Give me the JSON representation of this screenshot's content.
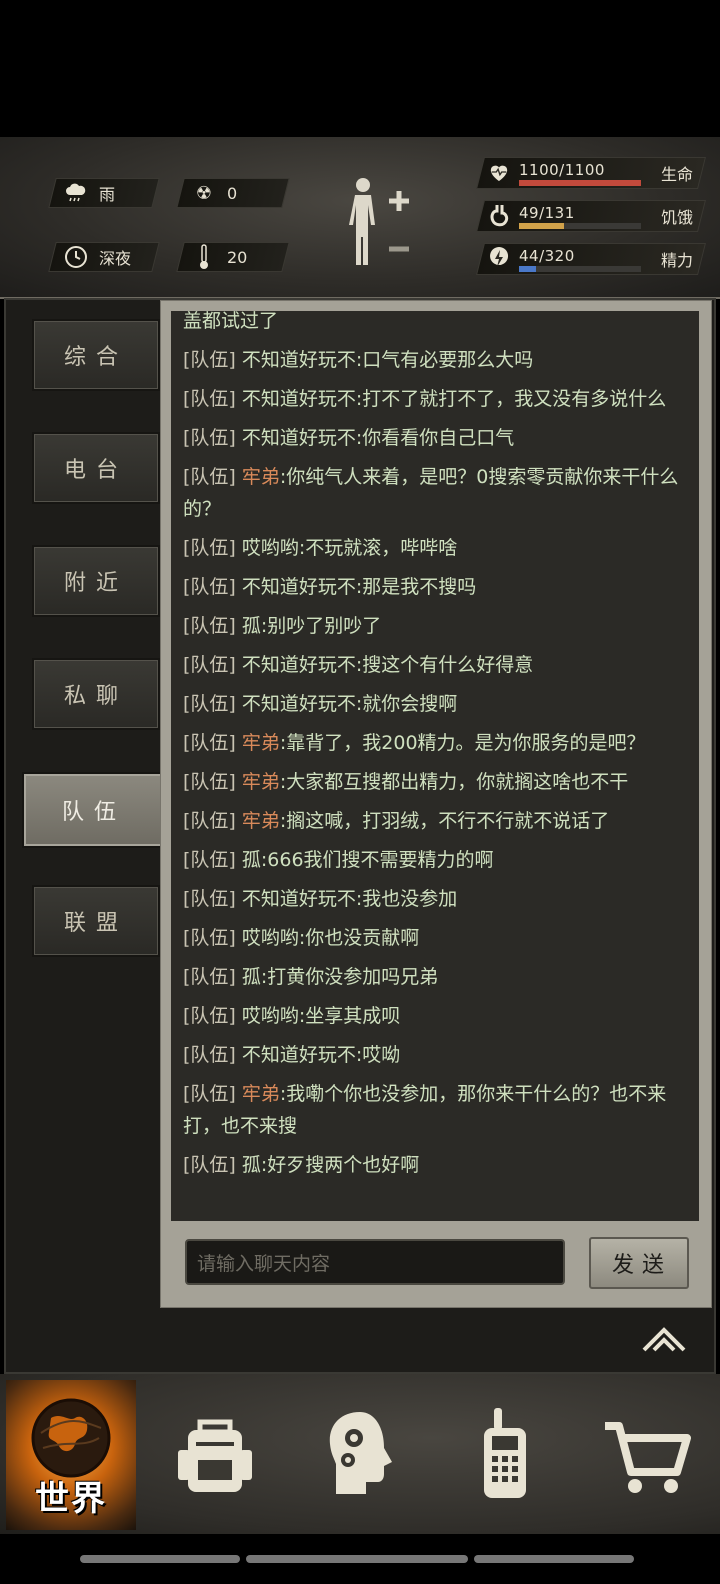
{
  "hud": {
    "weather": "雨",
    "radiation": "0",
    "time_of_day": "深夜",
    "temperature": "20",
    "vitals": [
      {
        "icon": "heart-icon",
        "value": "1100/1100",
        "label": "生命",
        "ratio": 1.0,
        "color": "#c24a3c"
      },
      {
        "icon": "stomach-icon",
        "value": "49/131",
        "label": "饥饿",
        "ratio": 0.374,
        "color": "#d1a24a"
      },
      {
        "icon": "energy-icon",
        "value": "44/320",
        "label": "精力",
        "ratio": 0.1375,
        "color": "#4a78c8"
      }
    ]
  },
  "tabs": [
    {
      "label": "综合",
      "active": false
    },
    {
      "label": "电台",
      "active": false
    },
    {
      "label": "附近",
      "active": false
    },
    {
      "label": "私聊",
      "active": false
    },
    {
      "label": "队伍",
      "active": true
    },
    {
      "label": "联盟",
      "active": false
    }
  ],
  "chat": {
    "partial_top": "盖都试过了",
    "channel": "[队伍]",
    "messages": [
      {
        "name": "不知道好玩不",
        "hl": false,
        "text": ":口气有必要那么大吗"
      },
      {
        "name": "不知道好玩不",
        "hl": false,
        "text": ":打不了就打不了，我又没有多说什么"
      },
      {
        "name": "不知道好玩不",
        "hl": false,
        "text": ":你看看你自己口气"
      },
      {
        "name": "牢弟",
        "hl": true,
        "text": ":你纯气人来着，是吧？0搜索零贡献你来干什么的？"
      },
      {
        "name": "哎哟哟",
        "hl": false,
        "text": ":不玩就滚，哔哔啥"
      },
      {
        "name": "不知道好玩不",
        "hl": false,
        "text": ":那是我不搜吗"
      },
      {
        "name": "孤",
        "hl": false,
        "text": ":别吵了别吵了"
      },
      {
        "name": "不知道好玩不",
        "hl": false,
        "text": ":搜这个有什么好得意"
      },
      {
        "name": "不知道好玩不",
        "hl": false,
        "text": ":就你会搜啊"
      },
      {
        "name": "牢弟",
        "hl": true,
        "text": ":靠背了，我200精力。是为你服务的是吧？"
      },
      {
        "name": "牢弟",
        "hl": true,
        "text": ":大家都互搜都出精力，你就搁这啥也不干"
      },
      {
        "name": "牢弟",
        "hl": true,
        "text": ":搁这喊，打羽绒，不行不行就不说话了"
      },
      {
        "name": "孤",
        "hl": false,
        "text": ":666我们搜不需要精力的啊"
      },
      {
        "name": "不知道好玩不",
        "hl": false,
        "text": ":我也没参加"
      },
      {
        "name": "哎哟哟",
        "hl": false,
        "text": ":你也没贡献啊"
      },
      {
        "name": "孤",
        "hl": false,
        "text": ":打黄你没参加吗兄弟"
      },
      {
        "name": "哎哟哟",
        "hl": false,
        "text": ":坐享其成呗"
      },
      {
        "name": "不知道好玩不",
        "hl": false,
        "text": ":哎呦"
      },
      {
        "name": "牢弟",
        "hl": true,
        "text": ":我嘞个你也没参加，那你来干什么的？也不来打，也不来搜"
      },
      {
        "name": "孤",
        "hl": false,
        "text": ":好歹搜两个也好啊"
      }
    ],
    "input_placeholder": "请输入聊天内容",
    "send_label": "发送"
  },
  "nav": {
    "world_label": "世界",
    "items": [
      "backpack-icon",
      "skills-head-icon",
      "radio-icon",
      "shop-cart-icon"
    ]
  }
}
